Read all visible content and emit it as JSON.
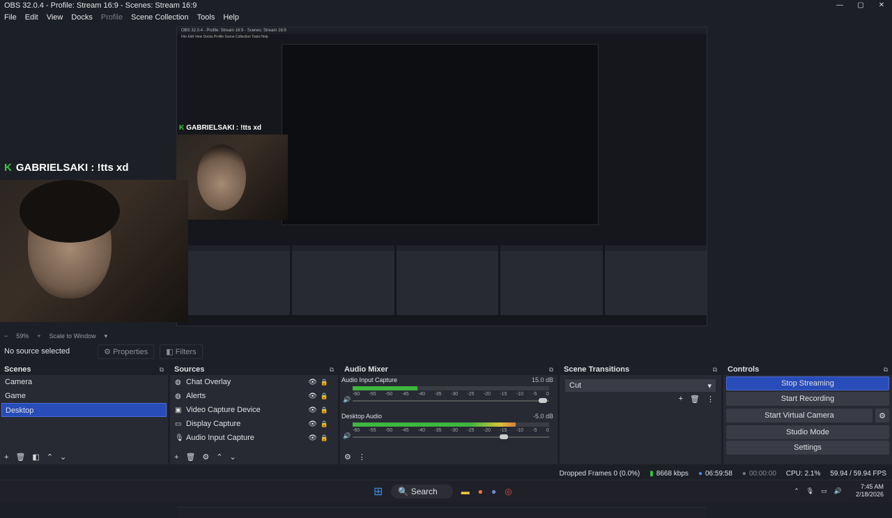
{
  "window": {
    "title": "OBS 32.0.4 - Profile: Stream 16:9 - Scenes: Stream 16:9",
    "min": "—",
    "max": "▢",
    "close": "✕"
  },
  "menu": [
    "File",
    "Edit",
    "View",
    "Docks",
    "Profile",
    "Scene Collection",
    "Tools",
    "Help"
  ],
  "preview": {
    "chat_main": "GABRIELSAKI : !tts xd",
    "chat_nested": "GABRIELSAKI : !tts xd",
    "nested_title": "OBS 32.0.4 - Profile: Stream 16:9 - Scenes: Stream 16:9",
    "nested_menu": "File  Edit  View  Docks  Profile  Scene Collection  Tools  Help"
  },
  "zoom": {
    "minus": "−",
    "value": "59%",
    "plus": "+",
    "mode": "Scale to Window"
  },
  "source_bar": {
    "status": "No source selected",
    "properties": "Properties",
    "filters": "Filters"
  },
  "scenes": {
    "title": "Scenes",
    "items": [
      "Camera",
      "Game",
      "Desktop"
    ],
    "selected": 2
  },
  "sources": {
    "title": "Sources",
    "items": [
      {
        "name": "Chat Overlay",
        "icon": "globe-icon"
      },
      {
        "name": "Alerts",
        "icon": "globe-icon"
      },
      {
        "name": "Video Capture Device",
        "icon": "camera-icon"
      },
      {
        "name": "Display Capture",
        "icon": "monitor-icon"
      },
      {
        "name": "Audio Input Capture",
        "icon": "microphone-icon"
      }
    ]
  },
  "mixer": {
    "title": "Audio Mixer",
    "channels": [
      {
        "name": "Audio Input Capture",
        "db": "15.0 dB",
        "level": 0.33,
        "vol": 0.99
      },
      {
        "name": "Desktop Audio",
        "db": "-5.0 dB",
        "level": 0.83,
        "vol": 0.79
      }
    ],
    "ticks": [
      "-60",
      "-55",
      "-50",
      "-45",
      "-40",
      "-35",
      "-30",
      "-25",
      "-20",
      "-15",
      "-10",
      "-5",
      "0"
    ]
  },
  "transitions": {
    "title": "Scene Transitions",
    "value": "Cut"
  },
  "controls": {
    "title": "Controls",
    "buttons": [
      "Stop Streaming",
      "Start Recording",
      "Start Virtual Camera",
      "Studio Mode",
      "Settings"
    ]
  },
  "status": {
    "dropped": "Dropped Frames 0 (0.0%)",
    "kbps": "8668 kbps",
    "stream_time": "06:59:58",
    "rec_time": "00:00:00",
    "cpu": "CPU: 2.1%",
    "fps": "59.94 / 59.94 FPS"
  },
  "taskbar": {
    "search": "Search",
    "time": "7:45 AM",
    "date": "2/18/2026"
  },
  "colors": {
    "accent": "#284cb8",
    "dock": "#272a33",
    "bg": "#1d1f26"
  }
}
